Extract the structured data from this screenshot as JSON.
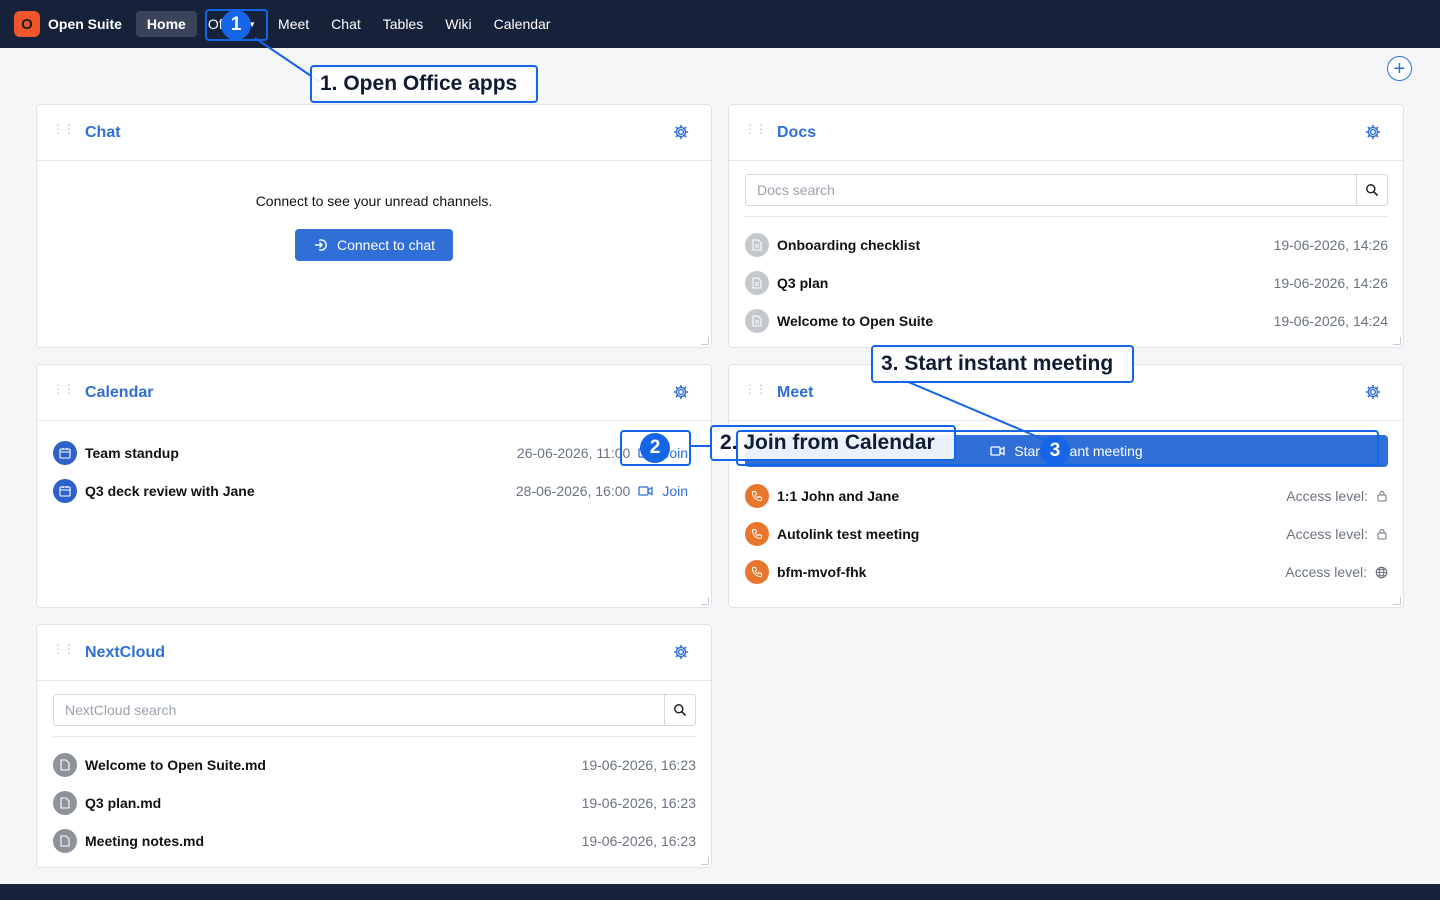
{
  "brand": {
    "logo_letter": "O",
    "name": "Open Suite"
  },
  "nav": {
    "items": [
      {
        "label": "Home",
        "active": true
      },
      {
        "label": "Office",
        "dropdown": true
      },
      {
        "label": "Meet"
      },
      {
        "label": "Chat"
      },
      {
        "label": "Tables"
      },
      {
        "label": "Wiki"
      },
      {
        "label": "Calendar"
      }
    ]
  },
  "add_widget_icon": "plus-circle-icon",
  "chat_widget": {
    "title": "Chat",
    "message": "Connect to see your unread channels.",
    "connect_button": "Connect to chat"
  },
  "docs_widget": {
    "title": "Docs",
    "search_placeholder": "Docs search",
    "items": [
      {
        "name": "Onboarding checklist",
        "date": "19-06-2026, 14:26"
      },
      {
        "name": "Q3 plan",
        "date": "19-06-2026, 14:26"
      },
      {
        "name": "Welcome to Open Suite",
        "date": "19-06-2026, 14:24"
      }
    ]
  },
  "calendar_widget": {
    "title": "Calendar",
    "join_label": "Join",
    "events": [
      {
        "name": "Team standup",
        "date": "26-06-2026, 11:00"
      },
      {
        "name": "Q3 deck review with Jane",
        "date": "28-06-2026, 16:00"
      }
    ]
  },
  "meet_widget": {
    "title": "Meet",
    "instant_button": "Start instant meeting",
    "access_label": "Access level:",
    "meetings": [
      {
        "name": "1:1 John and Jane",
        "access": "lock-icon"
      },
      {
        "name": "Autolink test meeting",
        "access": "lock-icon"
      },
      {
        "name": "bfm-mvof-fhk",
        "access": "globe-icon"
      }
    ]
  },
  "nextcloud_widget": {
    "title": "NextCloud",
    "search_placeholder": "NextCloud search",
    "files": [
      {
        "name": "Welcome to Open Suite.md",
        "date": "19-06-2026, 16:23"
      },
      {
        "name": "Q3 plan.md",
        "date": "19-06-2026, 16:23"
      },
      {
        "name": "Meeting notes.md",
        "date": "19-06-2026, 16:23"
      }
    ]
  },
  "annotations": [
    {
      "badge": "1",
      "label": "1. Open Office apps"
    },
    {
      "badge": "2",
      "label": "2. Join from Calendar"
    },
    {
      "badge": "3",
      "label": "3. Start instant meeting"
    }
  ],
  "colors": {
    "accent": "#2f6fd6",
    "nav_bg": "#16213a",
    "annotation": "#1565e8",
    "logo": "#f0562a"
  }
}
